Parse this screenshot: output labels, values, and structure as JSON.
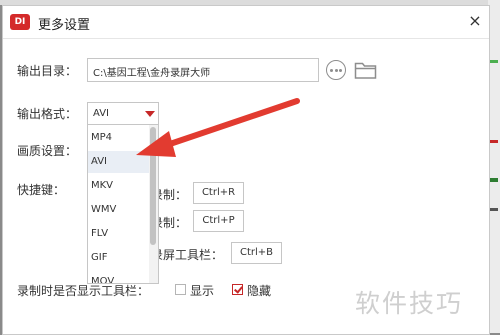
{
  "window": {
    "title": "更多设置",
    "app_icon_text": "DI",
    "close_glyph": "×"
  },
  "output_dir": {
    "label": "输出目录：",
    "value": "C:\\基因工程\\金舟录屏大师"
  },
  "output_format": {
    "label": "输出格式：",
    "selected": "AVI",
    "options": [
      "MP4",
      "AVI",
      "MKV",
      "WMV",
      "FLV",
      "GIF",
      "MOV"
    ]
  },
  "quality": {
    "label": "画质设置："
  },
  "hotkeys": {
    "label": "快捷键：",
    "rows": [
      {
        "label": "录制：",
        "key": "Ctrl+R"
      },
      {
        "label": "录制：",
        "key": "Ctrl+P"
      },
      {
        "label": "录屏工具栏：",
        "key": "Ctrl+B"
      }
    ]
  },
  "toolbar_display": {
    "label": "录制时是否显示工具栏：",
    "show_label": "显示",
    "hide_label": "隐藏",
    "show_checked": false,
    "hide_checked": true
  },
  "watermark": "软件技巧",
  "colors": {
    "accent": "#d42a2a",
    "arrow": "#e23b30"
  }
}
